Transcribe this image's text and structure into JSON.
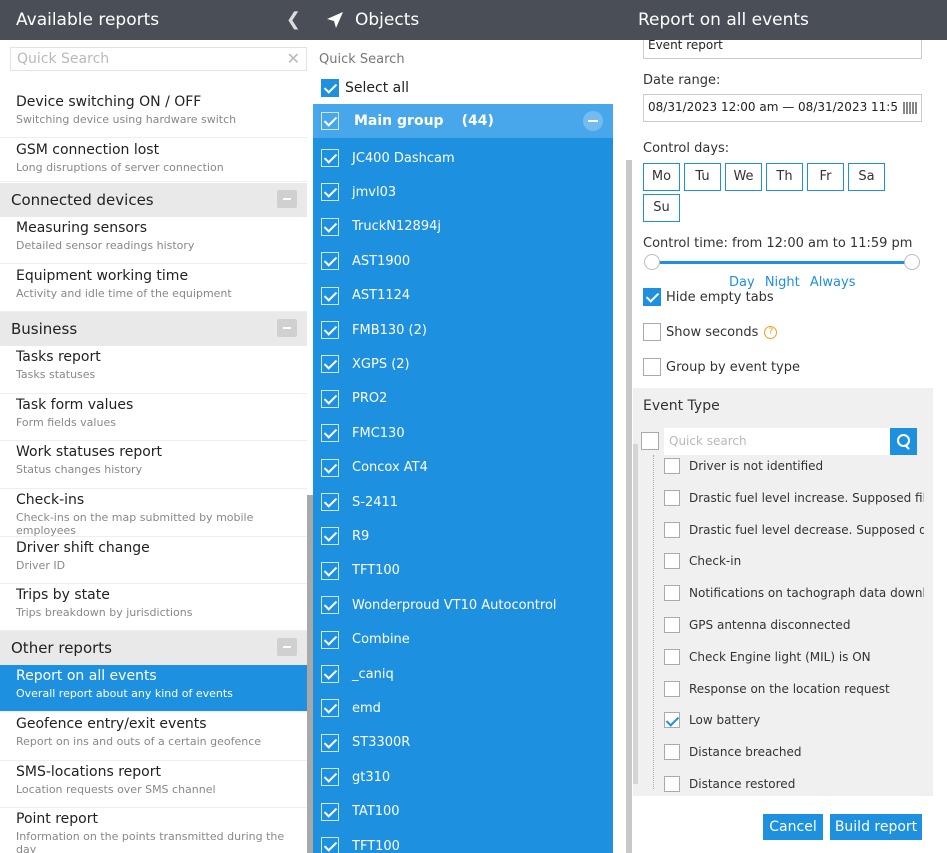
{
  "left": {
    "title": "Available reports",
    "search_placeholder": "Quick Search",
    "items": [
      {
        "title": "Device switching ON / OFF",
        "sub": "Switching device using hardware switch"
      },
      {
        "title": "GSM connection lost",
        "sub": "Long disruptions of server connection"
      }
    ],
    "cat_connected": "Connected devices",
    "connected": [
      {
        "title": "Measuring sensors",
        "sub": "Detailed sensor readings history"
      },
      {
        "title": "Equipment working time",
        "sub": "Activity and idle time of the equipment"
      }
    ],
    "cat_business": "Business",
    "business": [
      {
        "title": "Tasks report",
        "sub": "Tasks statuses"
      },
      {
        "title": "Task form values",
        "sub": "Form fields values"
      },
      {
        "title": "Work statuses report",
        "sub": "Status changes history"
      },
      {
        "title": "Check-ins",
        "sub": "Check-ins on the map submitted by mobile employees"
      },
      {
        "title": "Driver shift change",
        "sub": "Driver ID"
      },
      {
        "title": "Trips by state",
        "sub": "Trips breakdown by jurisdictions"
      }
    ],
    "cat_other": "Other reports",
    "other": [
      {
        "title": "Report on all events",
        "sub": "Overall report about any kind of events"
      },
      {
        "title": "Geofence entry/exit events",
        "sub": "Report on ins and outs of a certain geofence"
      },
      {
        "title": "SMS-locations report",
        "sub": "Location requests over SMS channel"
      },
      {
        "title": "Point report",
        "sub": "Information on the points transmitted during the day"
      }
    ]
  },
  "objects": {
    "title": "Objects",
    "search_placeholder": "Quick Search",
    "select_all": "Select all",
    "group_name": "Main group",
    "group_count": "(44)",
    "items": [
      "JC400 Dashcam",
      "jmvl03",
      "TruckN12894j",
      "AST1900",
      "AST1124",
      "FMB130 (2)",
      "XGPS (2)",
      "PRO2",
      "FMC130",
      "Concox AT4",
      "S-2411",
      "R9",
      "TFT100",
      "Wonderproud VT10 Autocontrol",
      "Combine",
      "_caniq",
      "emd",
      "ST3300R",
      "gt310",
      "TAT100",
      "TFT100"
    ]
  },
  "report": {
    "title": "Report on all events",
    "report_name": "Event report",
    "date_label": "Date range:",
    "date_value": "08/31/2023 12:00 am — 08/31/2023 11:5",
    "control_days_label": "Control days:",
    "days": [
      "Mo",
      "Tu",
      "We",
      "Th",
      "Fr",
      "Sa",
      "Su"
    ],
    "control_time": "Control time: from 12:00 am to 11:59 pm",
    "time_links": [
      "Day",
      "Night",
      "Always"
    ],
    "hide_empty": "Hide empty tabs",
    "show_seconds": "Show seconds",
    "group_by": "Group by event type",
    "event_type_title": "Event Type",
    "event_search_placeholder": "Quick search",
    "events": [
      {
        "label": "Driver is not identified",
        "checked": false
      },
      {
        "label": "Drastic fuel level increase. Supposed filli...",
        "checked": false
      },
      {
        "label": "Drastic fuel level decrease. Supposed dr...",
        "checked": false
      },
      {
        "label": "Check-in",
        "checked": false
      },
      {
        "label": "Notifications on tachograph data downl...",
        "checked": false
      },
      {
        "label": "GPS antenna disconnected",
        "checked": false
      },
      {
        "label": "Check Engine light (MIL) is ON",
        "checked": false
      },
      {
        "label": "Response on the location request",
        "checked": false
      },
      {
        "label": "Low battery",
        "checked": true
      },
      {
        "label": "Distance breached",
        "checked": false
      },
      {
        "label": "Distance restored",
        "checked": false
      }
    ],
    "cancel": "Cancel",
    "build": "Build report"
  },
  "colors": {
    "accent": "#1e90e0",
    "header": "#4a4f57"
  }
}
